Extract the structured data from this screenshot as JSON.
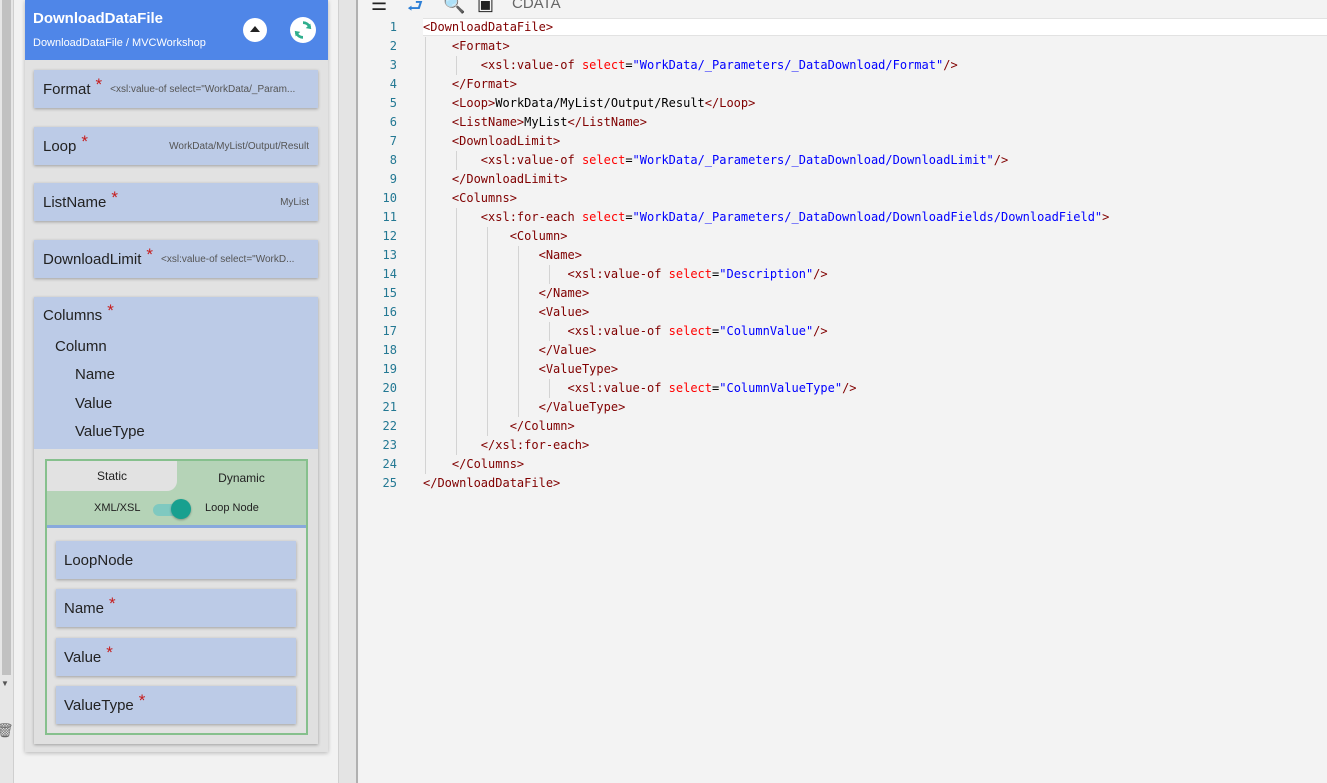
{
  "header": {
    "title": "DownloadDataFile",
    "breadcrumb": "DownloadDataFile / MVCWorkshop"
  },
  "fields": [
    {
      "label": "Format",
      "value": "<xsl:value-of select=\"WorkData/_Param..."
    },
    {
      "label": "Loop",
      "value": "WorkData/MyList/Output/Result"
    },
    {
      "label": "ListName",
      "value": "MyList"
    },
    {
      "label": "DownloadLimit",
      "value": "<xsl:value-of select=\"WorkD..."
    }
  ],
  "columns": {
    "label": "Columns",
    "tree": [
      "Column",
      "Name",
      "Value",
      "ValueType"
    ],
    "tabs": {
      "static": "Static",
      "dynamic": "Dynamic"
    },
    "toggle": {
      "left": "XML/XSL",
      "right": "Loop Node",
      "state": "Loop Node"
    },
    "subfields": [
      "LoopNode",
      "Name",
      "Value",
      "ValueType"
    ]
  },
  "toolbar": {
    "cdata": "CDATA"
  },
  "editor": {
    "line_numbers": [
      "1",
      "2",
      "3",
      "4",
      "5",
      "6",
      "7",
      "8",
      "9",
      "10",
      "11",
      "12",
      "13",
      "14",
      "15",
      "16",
      "17",
      "18",
      "19",
      "20",
      "21",
      "22",
      "23",
      "24",
      "25"
    ]
  },
  "colors": {
    "header_bg": "#4f86e8",
    "field_bg": "#bccbe7",
    "required": "#c61b1b",
    "dynamic_tab": "#b5d3b7",
    "toggle_on": "#17a08f"
  }
}
